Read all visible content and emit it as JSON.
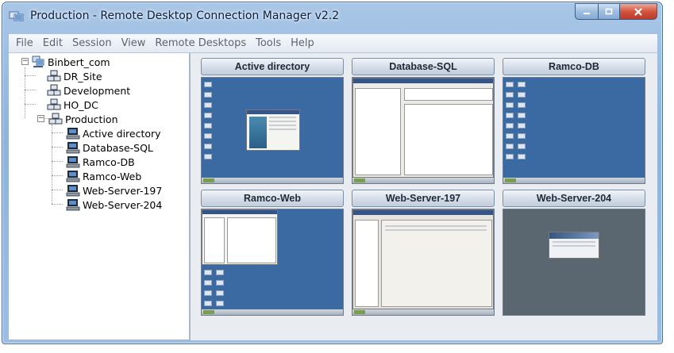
{
  "window": {
    "title": "Production - Remote Desktop Connection Manager v2.2"
  },
  "menu": [
    "File",
    "Edit",
    "Session",
    "View",
    "Remote Desktops",
    "Tools",
    "Help"
  ],
  "tree": {
    "root": "Binbert_com",
    "groups": [
      "DR_Site",
      "Development",
      "HO_DC",
      "Production"
    ],
    "servers": [
      "Active directory",
      "Database-SQL",
      "Ramco-DB",
      "Ramco-Web",
      "Web-Server-197",
      "Web-Server-204"
    ]
  },
  "thumbnails": [
    {
      "title": "Active directory"
    },
    {
      "title": "Database-SQL"
    },
    {
      "title": "Ramco-DB"
    },
    {
      "title": "Ramco-Web"
    },
    {
      "title": "Web-Server-197"
    },
    {
      "title": "Web-Server-204"
    }
  ],
  "icons": {
    "app": "rdcman-app-icon",
    "group": "server-group-icon",
    "server": "computer-icon"
  },
  "colors": {
    "desktop_blue": "#3a6aa1",
    "desktop_gray": "#5b6770",
    "close_red": "#c0392b"
  }
}
